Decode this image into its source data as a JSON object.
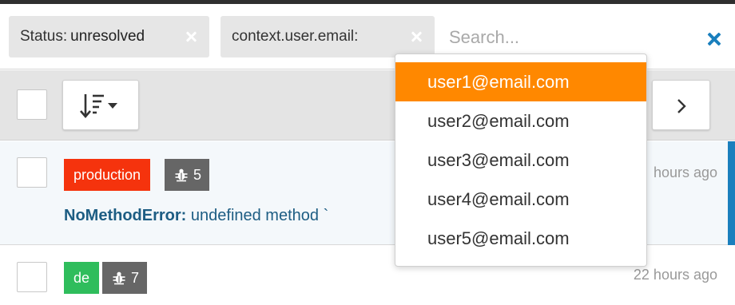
{
  "filters": [
    {
      "label": "Status:",
      "value": "unresolved"
    },
    {
      "label": "context.user.email:",
      "value": ""
    }
  ],
  "search": {
    "placeholder": "Search...",
    "value": ""
  },
  "suggestions": [
    "user1@email.com",
    "user2@email.com",
    "user3@email.com",
    "user4@email.com",
    "user5@email.com"
  ],
  "active_suggestion_index": 0,
  "issues": [
    {
      "environment": "production",
      "environment_color": "#f5330d",
      "occurrences": "5",
      "error_class": "NoMethodError:",
      "message": "undefined method `",
      "time_ago": "hours ago"
    },
    {
      "environment": "de",
      "environment_color": "#2fbd5c",
      "occurrences": "7",
      "time_ago": "22 hours ago"
    }
  ],
  "colors": {
    "accent_blue": "#1a7fbd",
    "highlight_orange": "#ff8800",
    "count_badge_gray": "#666666"
  },
  "icons": {
    "sort": "sort-descending-icon",
    "caret": "caret-down-icon",
    "next": "chevron-right-icon",
    "bug": "bug-icon",
    "clear": "close-icon"
  }
}
